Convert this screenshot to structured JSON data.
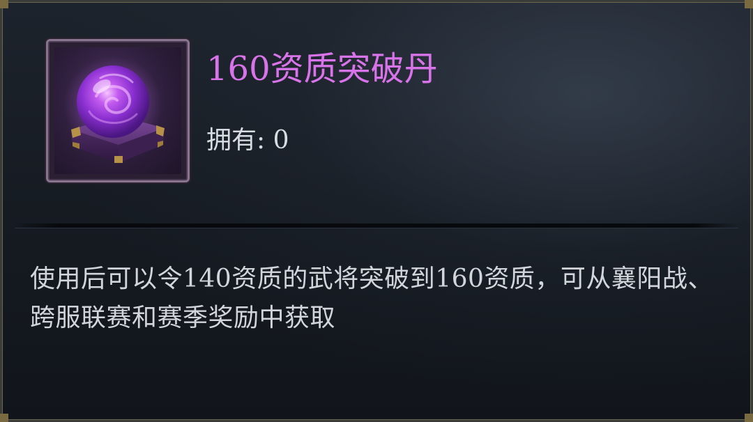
{
  "item": {
    "name": "160资质突破丹",
    "icon": "purple-orb-on-chest-icon",
    "name_color": "#d873ea"
  },
  "owned": {
    "label": "拥有:",
    "count": "0"
  },
  "description": "使用后可以令140资质的武将突破到160资质，可从襄阳战、跨服联赛和赛季奖励中获取"
}
